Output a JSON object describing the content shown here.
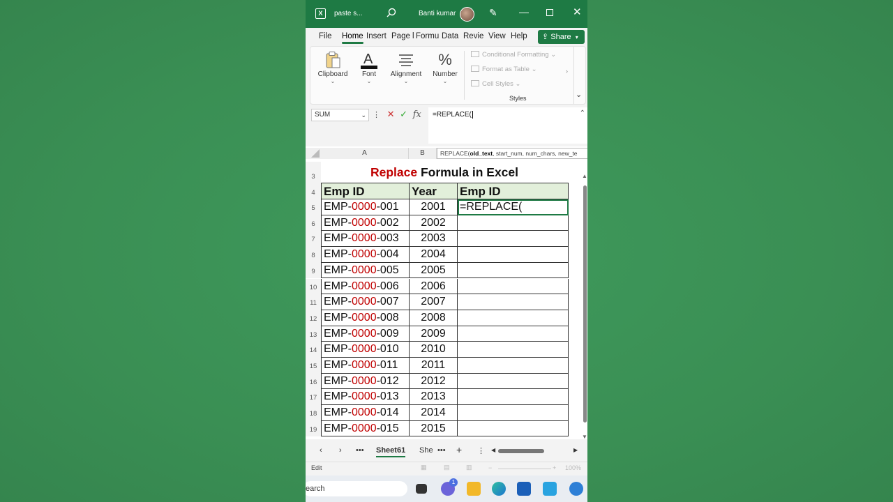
{
  "window": {
    "doc_title": "paste s...",
    "user_name": "Banti kumar"
  },
  "menu": {
    "tabs": [
      "File",
      "Home",
      "Insert",
      "Page l",
      "Formu",
      "Data",
      "Revie",
      "View",
      "Help"
    ],
    "active": "Home",
    "share_label": "Share"
  },
  "ribbon": {
    "clipboard": "Clipboard",
    "font": "Font",
    "alignment": "Alignment",
    "number": "Number",
    "conditional_formatting": "Conditional Formatting",
    "format_as_table": "Format as Table",
    "cell_styles": "Cell Styles",
    "styles_label": "Styles"
  },
  "formula_bar": {
    "name_box": "SUM",
    "formula": "=REPLACE(",
    "tooltip_fn": "REPLACE(",
    "tooltip_arg": "old_text",
    "tooltip_rest": ", start_num, num_chars, new_te"
  },
  "grid": {
    "columns": [
      "A",
      "B"
    ],
    "title_part1": "Replace",
    "title_part2": " Formula in Excel",
    "headers": [
      "Emp ID",
      "Year",
      "Emp ID"
    ],
    "rows": [
      {
        "num": "5",
        "prefix": "EMP-",
        "mid": "0000",
        "suffix": "-001",
        "year": "2001",
        "c": "=REPLACE("
      },
      {
        "num": "6",
        "prefix": "EMP-",
        "mid": "0000",
        "suffix": "-002",
        "year": "2002",
        "c": ""
      },
      {
        "num": "7",
        "prefix": "EMP-",
        "mid": "0000",
        "suffix": "-003",
        "year": "2003",
        "c": ""
      },
      {
        "num": "8",
        "prefix": "EMP-",
        "mid": "0000",
        "suffix": "-004",
        "year": "2004",
        "c": ""
      },
      {
        "num": "9",
        "prefix": "EMP-",
        "mid": "0000",
        "suffix": "-005",
        "year": "2005",
        "c": ""
      },
      {
        "num": "10",
        "prefix": "EMP-",
        "mid": "0000",
        "suffix": "-006",
        "year": "2006",
        "c": ""
      },
      {
        "num": "11",
        "prefix": "EMP-",
        "mid": "0000",
        "suffix": "-007",
        "year": "2007",
        "c": ""
      },
      {
        "num": "12",
        "prefix": "EMP-",
        "mid": "0000",
        "suffix": "-008",
        "year": "2008",
        "c": ""
      },
      {
        "num": "13",
        "prefix": "EMP-",
        "mid": "0000",
        "suffix": "-009",
        "year": "2009",
        "c": ""
      },
      {
        "num": "14",
        "prefix": "EMP-",
        "mid": "0000",
        "suffix": "-010",
        "year": "2010",
        "c": ""
      },
      {
        "num": "15",
        "prefix": "EMP-",
        "mid": "0000",
        "suffix": "-011",
        "year": "2011",
        "c": ""
      },
      {
        "num": "16",
        "prefix": "EMP-",
        "mid": "0000",
        "suffix": "-012",
        "year": "2012",
        "c": ""
      },
      {
        "num": "17",
        "prefix": "EMP-",
        "mid": "0000",
        "suffix": "-013",
        "year": "2013",
        "c": ""
      },
      {
        "num": "18",
        "prefix": "EMP-",
        "mid": "0000",
        "suffix": "-014",
        "year": "2014",
        "c": ""
      },
      {
        "num": "19",
        "prefix": "EMP-",
        "mid": "0000",
        "suffix": "-015",
        "year": "2015",
        "c": ""
      }
    ]
  },
  "sheets": {
    "active": "Sheet61",
    "next": "She"
  },
  "status": {
    "mode": "Edit",
    "zoom": "100%"
  },
  "taskbar": {
    "search_text": "earch",
    "badge": "1"
  }
}
